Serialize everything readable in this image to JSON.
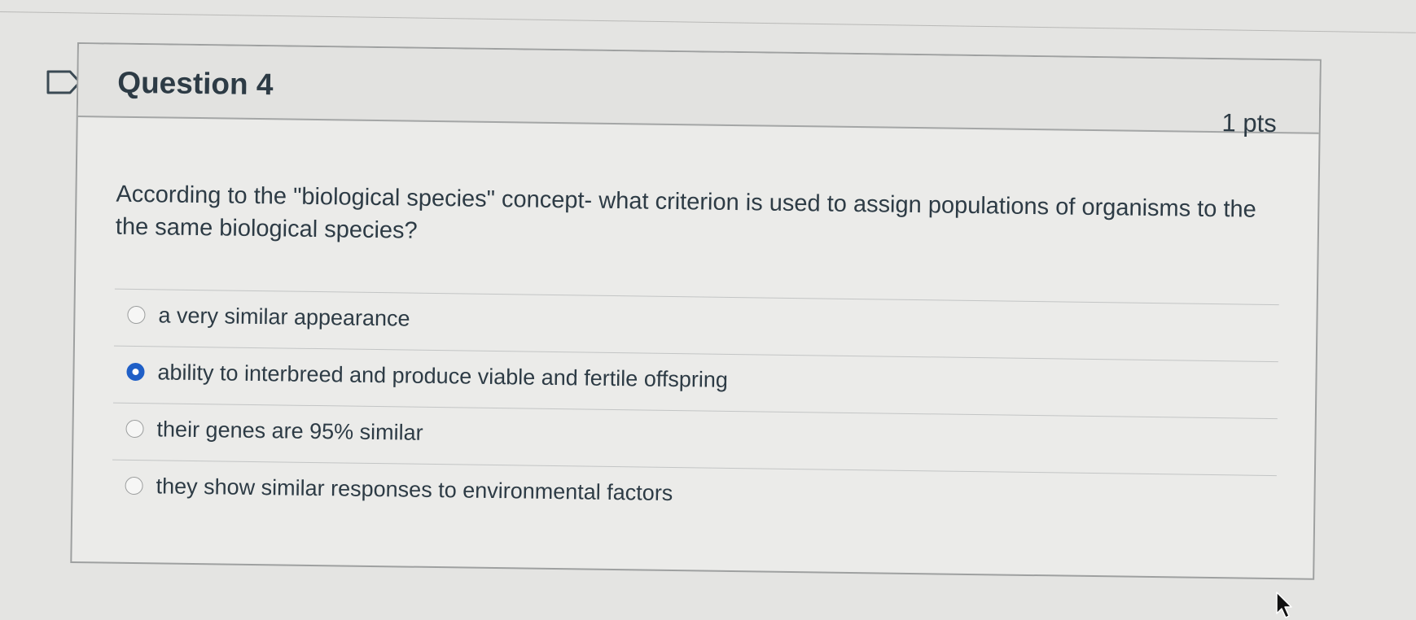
{
  "question": {
    "title": "Question 4",
    "points": "1 pts",
    "text": "According to the \"biological species\" concept- what criterion is used to assign populations of organisms to the the same biological species?"
  },
  "answers": [
    {
      "label": "a very similar appearance",
      "selected": false
    },
    {
      "label": "ability to interbreed and produce viable and fertile offspring",
      "selected": true
    },
    {
      "label": "their genes are 95% similar",
      "selected": false
    },
    {
      "label": "they show similar responses to environmental factors",
      "selected": false
    }
  ],
  "colors": {
    "selected_radio": "#1f5fc7",
    "text": "#2d3b45",
    "background": "#e4e4e2"
  },
  "icons": {
    "flag": "flag-question-icon",
    "cursor": "mouse-pointer-icon"
  }
}
